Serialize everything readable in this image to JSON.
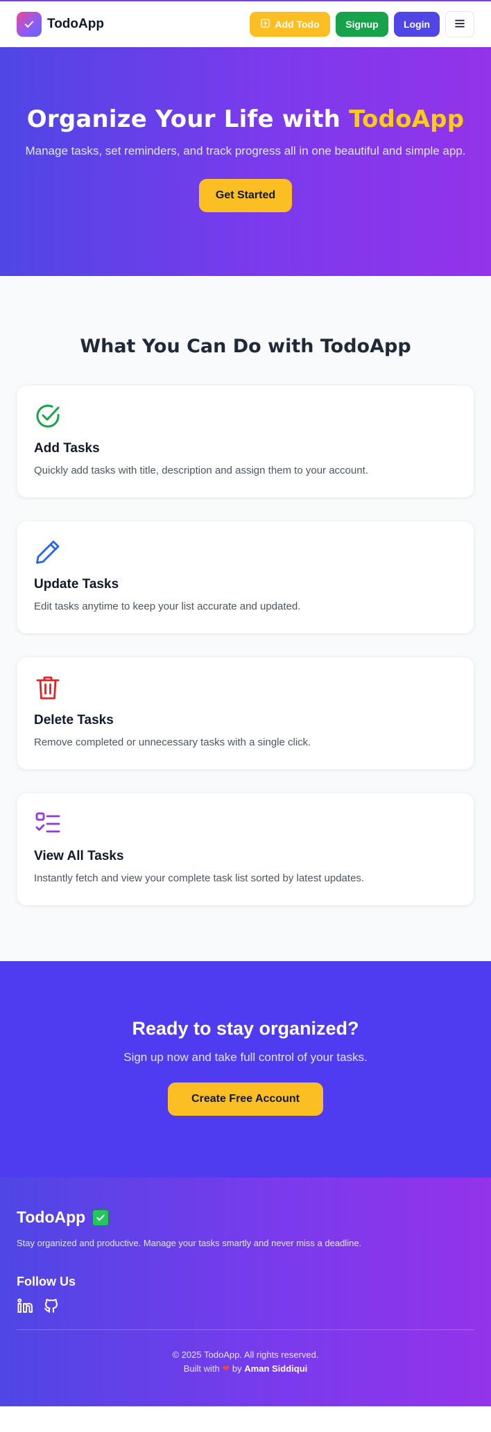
{
  "navbar": {
    "brand": "TodoApp",
    "add_todo_label": "Add Todo",
    "signup_label": "Signup",
    "login_label": "Login"
  },
  "hero": {
    "title_prefix": "Organize Your Life with ",
    "title_accent": "TodoApp",
    "subtitle": "Manage tasks, set reminders, and track progress all in one beautiful and simple app.",
    "cta_label": "Get Started"
  },
  "features": {
    "title": "What You Can Do with TodoApp",
    "items": [
      {
        "icon": "check-circle-icon",
        "title": "Add Tasks",
        "description": "Quickly add tasks with title, description and assign them to your account."
      },
      {
        "icon": "pencil-icon",
        "title": "Update Tasks",
        "description": "Edit tasks anytime to keep your list accurate and updated."
      },
      {
        "icon": "trash-icon",
        "title": "Delete Tasks",
        "description": "Remove completed or unnecessary tasks with a single click."
      },
      {
        "icon": "list-check-icon",
        "title": "View All Tasks",
        "description": "Instantly fetch and view your complete task list sorted by latest updates."
      }
    ]
  },
  "cta": {
    "title": "Ready to stay organized?",
    "subtitle": "Sign up now and take full control of your tasks.",
    "button_label": "Create Free Account"
  },
  "footer": {
    "brand": "TodoApp",
    "tagline": "Stay organized and productive. Manage your tasks smartly and never miss a deadline.",
    "follow_title": "Follow Us",
    "copyright": "© 2025 TodoApp. All rights reserved.",
    "built_with": "Built with",
    "by": "by",
    "author": "Aman Siddiqui"
  },
  "colors": {
    "primary": "#4f46e5",
    "accent_yellow": "#fbbf24",
    "signup_green": "#16a34a",
    "gradient_end": "#9333ea"
  }
}
